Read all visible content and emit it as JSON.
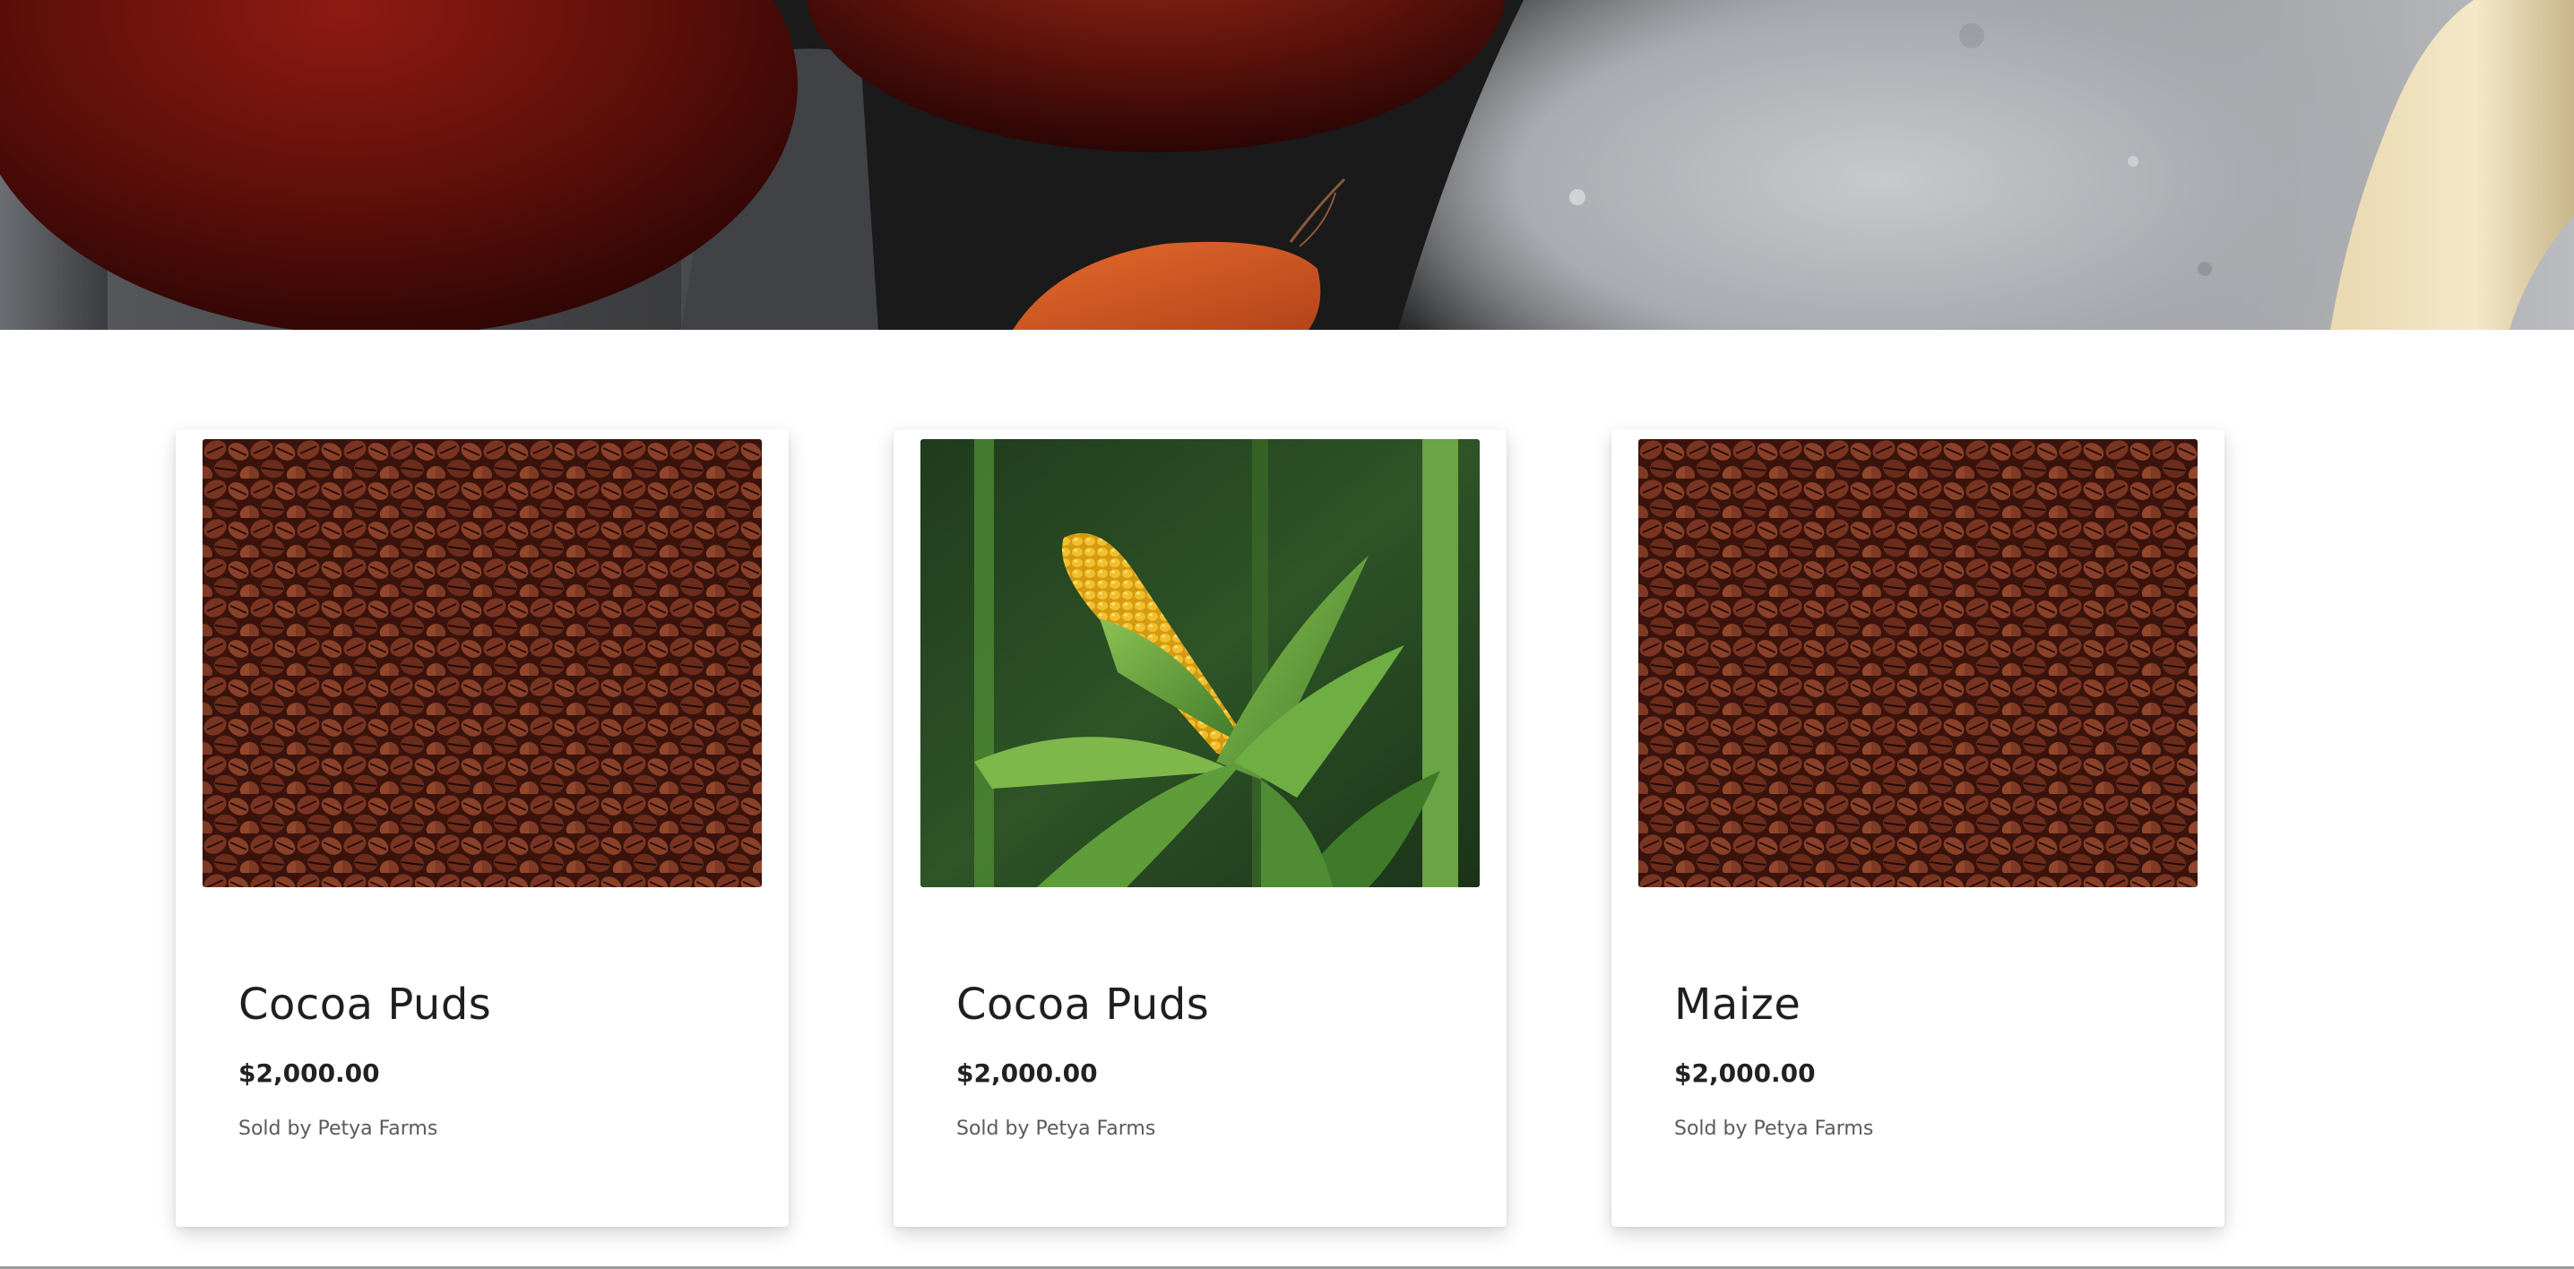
{
  "hero": {
    "image": "vegetables-on-stone-photo"
  },
  "products": [
    {
      "title": "Cocoa Puds",
      "price": "$2,000.00",
      "seller": "Sold by Petya Farms",
      "image": "coffee-beans-photo"
    },
    {
      "title": "Cocoa Puds",
      "price": "$2,000.00",
      "seller": "Sold by Petya Farms",
      "image": "corn-cob-photo"
    },
    {
      "title": "Maize",
      "price": "$2,000.00",
      "seller": "Sold by Petya Farms",
      "image": "coffee-beans-photo"
    }
  ],
  "colors": {
    "title": "#1f1f1f",
    "price": "#222222",
    "seller": "#5a5a5a",
    "card_background": "#ffffff"
  }
}
